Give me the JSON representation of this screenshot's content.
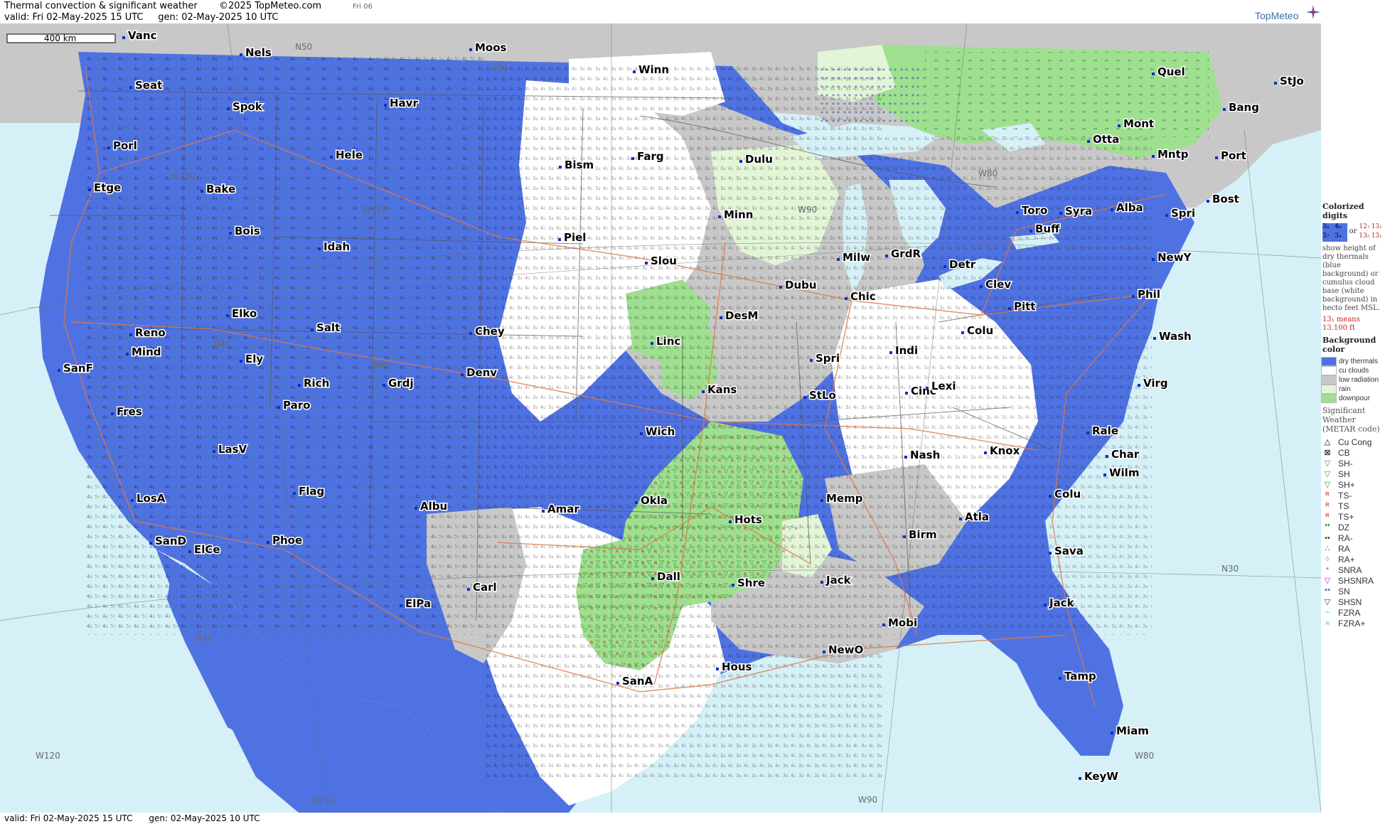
{
  "header": {
    "title": "Thermal convection & significant weather",
    "copyright": "©2025 TopMeteo.com",
    "day_tag": "Fri 06",
    "valid": "valid:  Fri  02-May-2025  15 UTC",
    "gen": "gen:  02-May-2025 10 UTC",
    "logo": "TopMeteo"
  },
  "footer": {
    "valid": "valid:  Fri  02-May-2025  15 UTC",
    "gen": "gen:  02-May-2025 10 UTC"
  },
  "scale_bar": "400 km",
  "colors": {
    "dry_thermals": "#4f72e3",
    "cu_clouds": "#ffffff",
    "low_radiation": "#c8c8c8",
    "rain": "#e2f5d6",
    "downpour": "#9ee08f",
    "ocean": "#d5f0f7",
    "roads": "#e07840",
    "borders": "#555555"
  },
  "cities": [
    "Vanc",
    "Nels",
    "Moos",
    "Seat",
    "Spok",
    "Havr",
    "Winn",
    "Quel",
    "StJo",
    "Bang",
    "Mont",
    "Otta",
    "Mntp",
    "Port",
    "Porl",
    "Hele",
    "Bism",
    "Farg",
    "Dulu",
    "Bake",
    "Etge",
    "Toro",
    "Syra",
    "Alba",
    "Bost",
    "Spri",
    "Buff",
    "NewY",
    "Bois",
    "Idah",
    "Piel",
    "Minn",
    "Slou",
    "Milw",
    "GrdR",
    "Detr",
    "Clev",
    "Pitt",
    "Phil",
    "Dubu",
    "Chic",
    "Elko",
    "Reno",
    "Mind",
    "Salt",
    "Chey",
    "DesM",
    "Linc",
    "Colu",
    "Wash",
    "SanF",
    "Ely",
    "Rich",
    "Grdj",
    "Denv",
    "Kans",
    "Spri",
    "Indi",
    "Cinc",
    "Lexi",
    "Virg",
    "Paro",
    "Fres",
    "StLo",
    "Wich",
    "Rale",
    "LasV",
    "Knox",
    "Nash",
    "Char",
    "Wilm",
    "Flag",
    "LosA",
    "Albu",
    "Okla",
    "Amar",
    "Memp",
    "Colu",
    "Hots",
    "SanD",
    "ElCe",
    "Phoe",
    "Atla",
    "Birm",
    "Sava",
    "Dall",
    "Shre",
    "Jack",
    "Carl",
    "ElPa",
    "Jack",
    "Mobi",
    "NewO",
    "Hous",
    "SanA",
    "Tamp",
    "Miam",
    "KeyW"
  ],
  "meridians": [
    "N50",
    "N50",
    "W120",
    "W110",
    "N40",
    "N40",
    "W90",
    "W80",
    "N30",
    "N30",
    "W120",
    "W110",
    "W90",
    "W80"
  ],
  "legend": {
    "colorized_title": "Colorized digits",
    "sample_or": "or",
    "sample_blue": [
      "3₄",
      "4₆",
      "3₇",
      "3₄"
    ],
    "sample_white": [
      "12₇",
      "13₁",
      "13₅",
      "13₁"
    ],
    "description": "show height of dry thermals (blue background) or cumulus cloud base (white background) in hecto feet MSL.",
    "note": "13₁ means 13.100 ft",
    "background_title": "Background color",
    "background": [
      {
        "label": "dry thermals",
        "color": "#4f72e3"
      },
      {
        "label": "cu clouds",
        "color": "#ffffff"
      },
      {
        "label": "low radiation",
        "color": "#c8c8c8"
      },
      {
        "label": "rain",
        "color": "#e2f5d6"
      },
      {
        "label": "downpour",
        "color": "#9ee08f"
      }
    ],
    "sigwx_title": "Significant Weather (METAR code)",
    "sigwx": [
      {
        "label": "Cu Cong",
        "glyph": "△",
        "color": "#000"
      },
      {
        "label": "CB",
        "glyph": "⊠",
        "color": "#000"
      },
      {
        "label": "SH-",
        "glyph": "▽",
        "color": "#3a9a2a"
      },
      {
        "label": "SH",
        "glyph": "▽",
        "color": "#3a9a2a"
      },
      {
        "label": "SH+",
        "glyph": "▽",
        "color": "#3a9a2a"
      },
      {
        "label": "TS-",
        "glyph": "ᴿ",
        "color": "#c02020"
      },
      {
        "label": "TS",
        "glyph": "ᴿ",
        "color": "#c02020"
      },
      {
        "label": "TS+",
        "glyph": "ᴿ",
        "color": "#c02020"
      },
      {
        "label": "DZ",
        "glyph": "❜❜",
        "color": "#1a6a1a"
      },
      {
        "label": "RA-",
        "glyph": "••",
        "color": "#1a6a1a"
      },
      {
        "label": "RA",
        "glyph": "∴",
        "color": "#1a6a1a"
      },
      {
        "label": "RA+",
        "glyph": "⁘",
        "color": "#1a6a1a"
      },
      {
        "label": "SNRA",
        "glyph": "*",
        "color": "#c030c0"
      },
      {
        "label": "SHSNRA",
        "glyph": "▽",
        "color": "#c030c0"
      },
      {
        "label": "SN",
        "glyph": "**",
        "color": "#2030c0"
      },
      {
        "label": "SHSN",
        "glyph": "▽",
        "color": "#2030c0"
      },
      {
        "label": "FZRA",
        "glyph": "~",
        "color": "#20b0d0"
      },
      {
        "label": "FZRA+",
        "glyph": "≈",
        "color": "#20b0d0"
      }
    ]
  }
}
